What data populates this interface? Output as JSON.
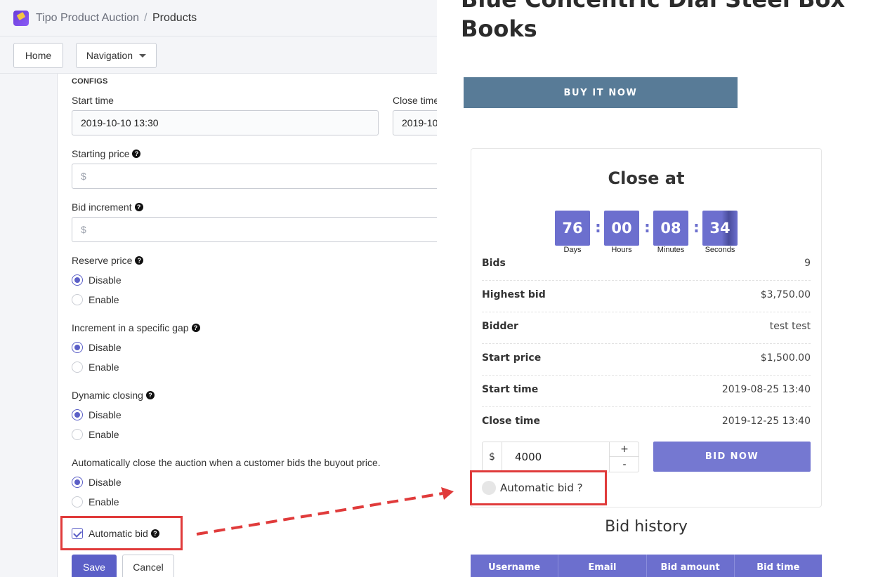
{
  "admin": {
    "breadcrumb": {
      "app": "Tipo Product Auction",
      "separator": "/",
      "current": "Products"
    },
    "nav": {
      "home": "Home",
      "navigation": "Navigation"
    },
    "section": "CONFIGS",
    "start_time": {
      "label": "Start time",
      "value": "2019-10-10 13:30"
    },
    "close_time": {
      "label": "Close time",
      "value": "2019-10"
    },
    "starting_price": {
      "label": "Starting price",
      "placeholder": "$"
    },
    "bid_increment": {
      "label": "Bid increment",
      "placeholder": "$"
    },
    "reserve_price": {
      "label": "Reserve price",
      "options": [
        "Disable",
        "Enable"
      ],
      "selected": "Disable"
    },
    "increment_gap": {
      "label": "Increment in a specific gap",
      "options": [
        "Disable",
        "Enable"
      ],
      "selected": "Disable"
    },
    "dynamic_closing": {
      "label": "Dynamic closing",
      "options": [
        "Disable",
        "Enable"
      ],
      "selected": "Disable"
    },
    "auto_close": {
      "label": "Automatically close the auction when a customer bids the buyout price.",
      "options": [
        "Disable",
        "Enable"
      ],
      "selected": "Disable"
    },
    "automatic_bid": {
      "label": "Automatic bid",
      "checked": true
    },
    "buttons": {
      "save": "Save",
      "cancel": "Cancel"
    },
    "help_glyph": "?"
  },
  "product": {
    "title": "Blue Concentric Dial Steel Box Books",
    "buy_now": "BUY IT NOW",
    "close_at": "Close at",
    "countdown": [
      {
        "value": "76",
        "unit": "Days"
      },
      {
        "value": "00",
        "unit": "Hours"
      },
      {
        "value": "08",
        "unit": "Minutes"
      },
      {
        "value": "34",
        "unit": "Seconds"
      }
    ],
    "countdown_sep": ":",
    "details": [
      {
        "key": "Bids",
        "value": "9"
      },
      {
        "key": "Highest bid",
        "value": "$3,750.00"
      },
      {
        "key": "Bidder",
        "value": "test test"
      },
      {
        "key": "Start price",
        "value": "$1,500.00"
      },
      {
        "key": "Start time",
        "value": "2019-08-25 13:40"
      },
      {
        "key": "Close time",
        "value": "2019-12-25 13:40"
      }
    ],
    "bid": {
      "currency": "$",
      "amount": "4000",
      "plus": "+",
      "minus": "-",
      "button": "BID NOW"
    },
    "automatic_bid": "Automatic bid ?",
    "bid_history": {
      "title": "Bid history",
      "columns": [
        "Username",
        "Email",
        "Bid amount",
        "Bid time"
      ]
    }
  },
  "colors": {
    "accent": "#5b5fc7",
    "countdown": "#6c6fce",
    "buy_button": "#587b97",
    "highlight": "#e03b3b"
  }
}
